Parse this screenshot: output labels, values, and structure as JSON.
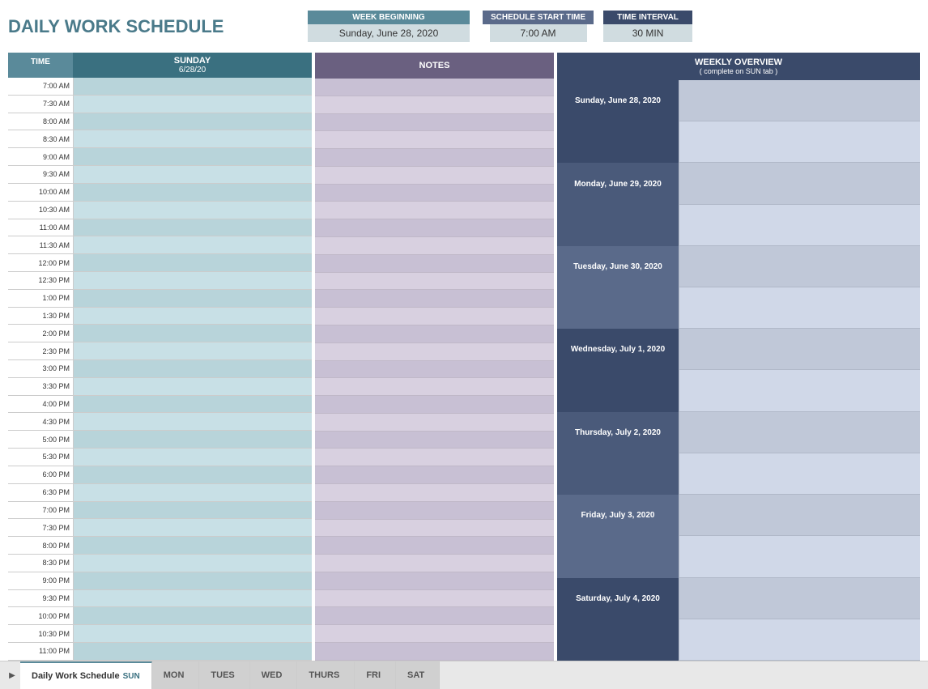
{
  "header": {
    "title": "DAILY WORK SCHEDULE",
    "week_beginning_label": "WEEK BEGINNING",
    "week_beginning_value": "Sunday, June 28, 2020",
    "schedule_start_label": "SCHEDULE START TIME",
    "schedule_start_value": "7:00 AM",
    "time_interval_label": "TIME INTERVAL",
    "time_interval_value": "30 MIN"
  },
  "schedule": {
    "time_col_header": "TIME",
    "day_col_header": "SUNDAY",
    "day_col_date": "6/28/20",
    "times": [
      "7:00 AM",
      "7:30 AM",
      "8:00 AM",
      "8:30 AM",
      "9:00 AM",
      "9:30 AM",
      "10:00 AM",
      "10:30 AM",
      "11:00 AM",
      "11:30 AM",
      "12:00 PM",
      "12:30 PM",
      "1:00 PM",
      "1:30 PM",
      "2:00 PM",
      "2:30 PM",
      "3:00 PM",
      "3:30 PM",
      "4:00 PM",
      "4:30 PM",
      "5:00 PM",
      "5:30 PM",
      "6:00 PM",
      "6:30 PM",
      "7:00 PM",
      "7:30 PM",
      "8:00 PM",
      "8:30 PM",
      "9:00 PM",
      "9:30 PM",
      "10:00 PM",
      "10:30 PM",
      "11:00 PM"
    ]
  },
  "notes": {
    "header": "NOTES"
  },
  "weekly_overview": {
    "title": "WEEKLY OVERVIEW",
    "subtitle": "( complete on SUN tab )",
    "days": [
      "Sunday, June 28, 2020",
      "Monday, June 29, 2020",
      "Tuesday, June 30, 2020",
      "Wednesday, July 1, 2020",
      "Thursday, July 2, 2020",
      "Friday, July 3, 2020",
      "Saturday, July 4, 2020"
    ]
  },
  "tabs": {
    "nav_arrow": "▶",
    "items": [
      {
        "label": "Daily Work Schedule",
        "sub": "SUN",
        "active": true
      },
      {
        "label": "MON",
        "sub": "",
        "active": false
      },
      {
        "label": "TUES",
        "sub": "",
        "active": false
      },
      {
        "label": "WED",
        "sub": "",
        "active": false
      },
      {
        "label": "THURS",
        "sub": "",
        "active": false
      },
      {
        "label": "FRI",
        "sub": "",
        "active": false
      },
      {
        "label": "SAT",
        "sub": "",
        "active": false
      }
    ]
  }
}
